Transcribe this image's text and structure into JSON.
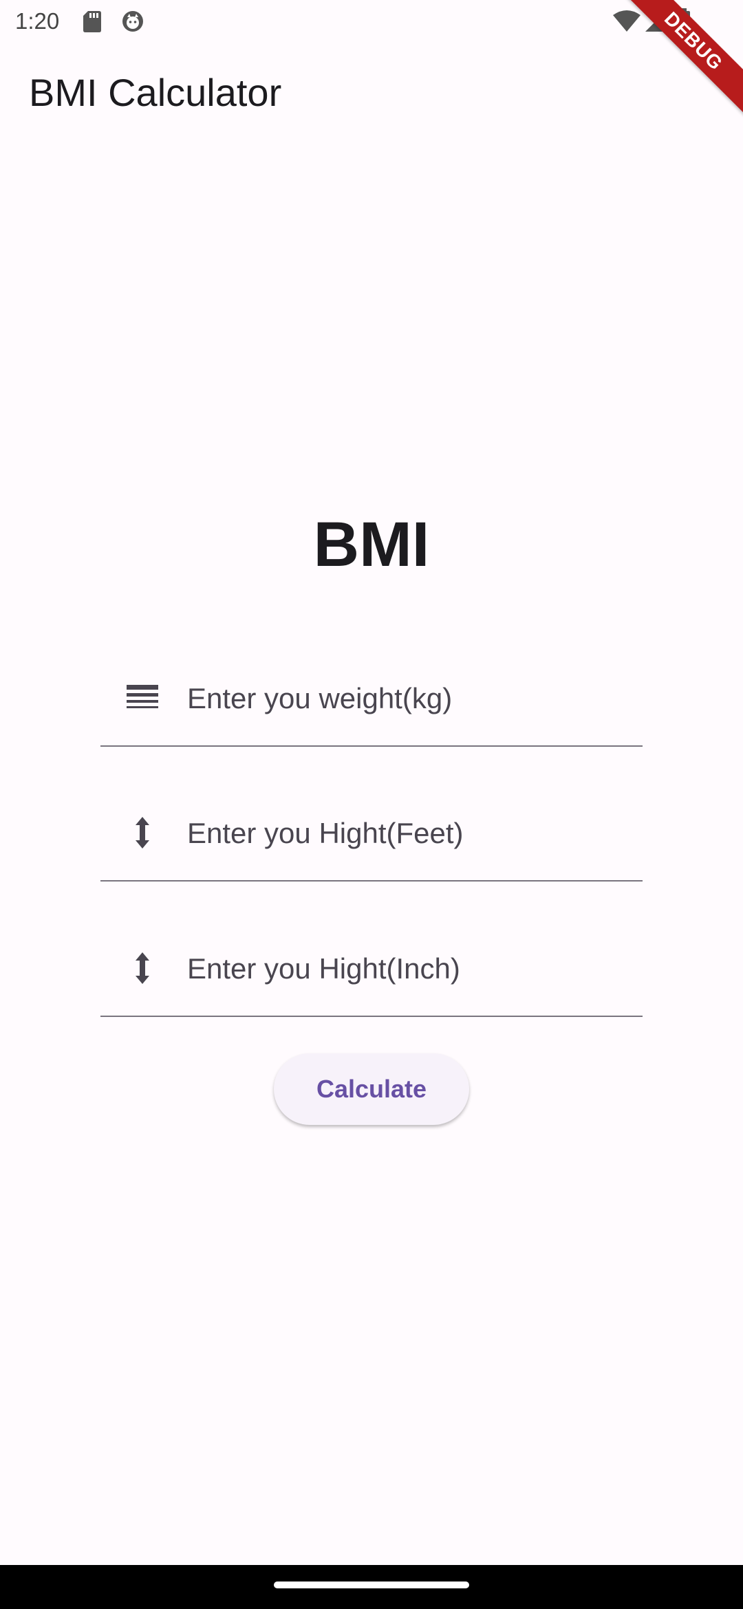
{
  "status_bar": {
    "time": "1:20",
    "icons": [
      "sd-card-icon",
      "cat-icon",
      "wifi-icon",
      "signal-icon",
      "battery-icon"
    ]
  },
  "debug_banner": "DEBUG",
  "app_bar": {
    "title": "BMI Calculator"
  },
  "main": {
    "heading": "BMI",
    "fields": [
      {
        "icon": "line-weight-icon",
        "value": "",
        "placeholder": "Enter you weight(kg)"
      },
      {
        "icon": "height-arrow-icon",
        "value": "",
        "placeholder": "Enter you Hight(Feet)"
      },
      {
        "icon": "height-arrow-icon",
        "value": "",
        "placeholder": "Enter you Hight(Inch)"
      }
    ],
    "calculate_label": "Calculate"
  },
  "colors": {
    "background": "#fffbfe",
    "accent": "#6750a4",
    "button_bg": "#f7f2fa",
    "ribbon": "#b71c1c",
    "underline": "#79747e"
  }
}
